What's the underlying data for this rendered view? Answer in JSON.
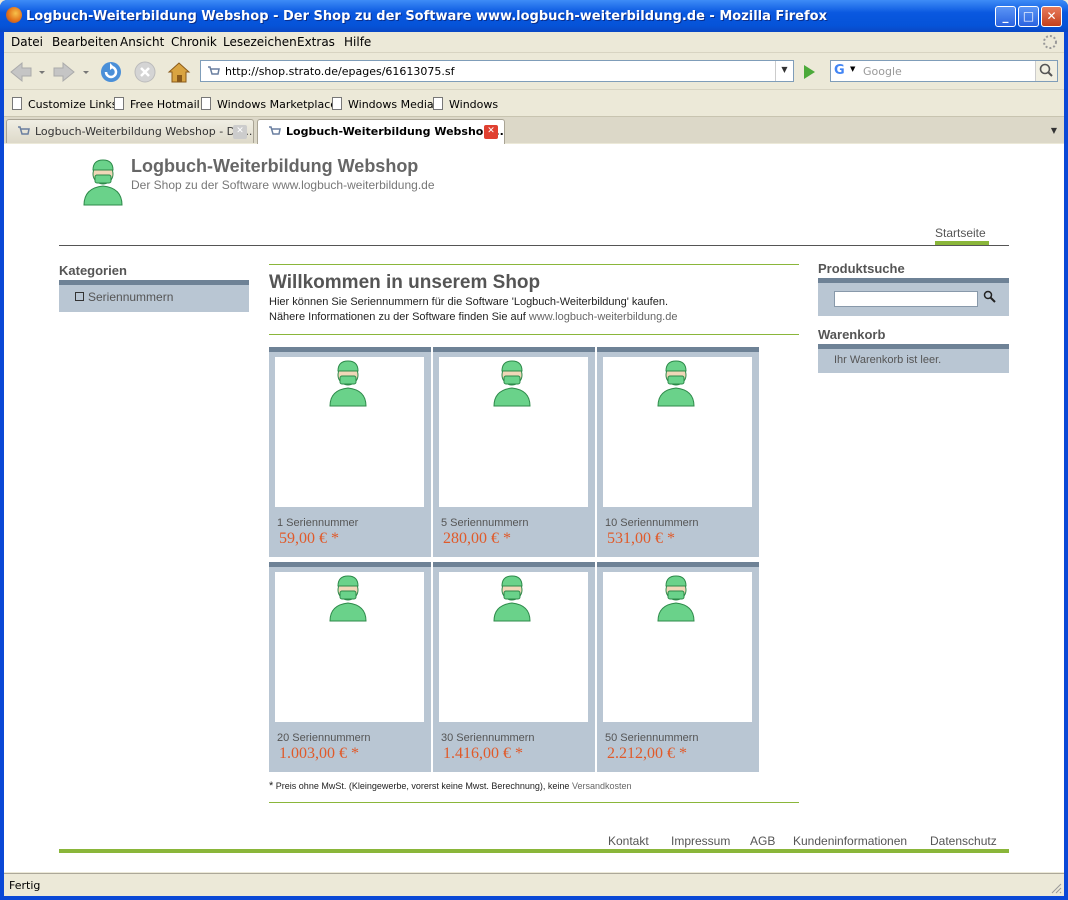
{
  "window": {
    "title": "Logbuch-Weiterbildung Webshop - Der Shop zu der Software www.logbuch-weiterbildung.de - Mozilla Firefox"
  },
  "menu": [
    "Datei",
    "Bearbeiten",
    "Ansicht",
    "Chronik",
    "Lesezeichen",
    "Extras",
    "Hilfe"
  ],
  "nav": {
    "url": "http://shop.strato.de/epages/61613075.sf",
    "search_placeholder": "Google"
  },
  "bookmarks": [
    "Customize Links",
    "Free Hotmail",
    "Windows Marketplace",
    "Windows Media",
    "Windows"
  ],
  "tabs": [
    {
      "label": "Logbuch-Weiterbildung Webshop - De..."
    },
    {
      "label": "Logbuch-Weiterbildung Webshop..."
    }
  ],
  "page": {
    "shop_title": "Logbuch-Weiterbildung Webshop",
    "shop_subtitle": "Der Shop zu der Software www.logbuch-weiterbildung.de",
    "topnav": "Startseite",
    "categories_heading": "Kategorien",
    "category_item": "Seriennummern",
    "welcome_heading": "Willkommen in unserem Shop",
    "intro_line1": "Hier können Sie Seriennummern für die Software 'Logbuch-Weiterbildung' kaufen.",
    "intro_line2_prefix": "Nähere Informationen zu der Software finden Sie auf",
    "intro_link": "www.logbuch-weiterbildung.de",
    "products": [
      {
        "name": "1 Seriennummer",
        "price": "59,00 € *"
      },
      {
        "name": "5 Seriennummern",
        "price": "280,00 € *"
      },
      {
        "name": "10 Seriennummern",
        "price": "531,00 € *"
      },
      {
        "name": "20 Seriennummern",
        "price": "1.003,00 € *"
      },
      {
        "name": "30 Seriennummern",
        "price": "1.416,00 € *"
      },
      {
        "name": "50 Seriennummern",
        "price": "2.212,00 € *"
      }
    ],
    "footnote_star": "*",
    "footnote_text": "Preis ohne MwSt. (Kleingewerbe, vorerst keine Mwst. Berechnung), keine",
    "footnote_link": "Versandkosten",
    "search_heading": "Produktsuche",
    "cart_heading": "Warenkorb",
    "cart_empty": "Ihr Warenkorb ist leer.",
    "footer_links": [
      "Kontakt",
      "Impressum",
      "AGB",
      "Kundeninformationen",
      "Datenschutz"
    ]
  },
  "status": "Fertig",
  "colors": {
    "accent_green": "#8ab63a",
    "price_red": "#e05a2a",
    "box_blue": "#b9c6d3",
    "box_border": "#6e8296"
  }
}
